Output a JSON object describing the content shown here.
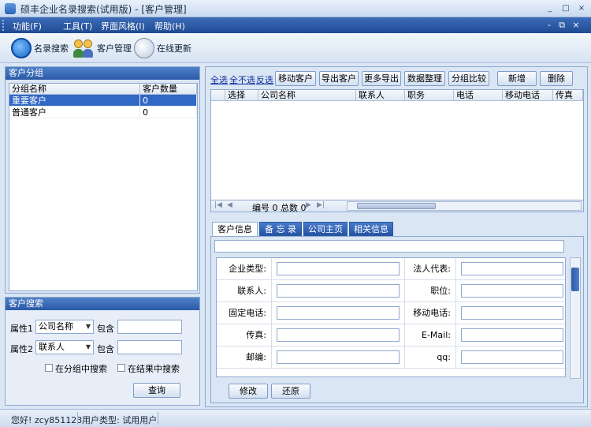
{
  "window": {
    "title": "硕丰企业名录搜索(试用版) - [客户管理]",
    "controls": [
      "_",
      "□",
      "×"
    ]
  },
  "menu": {
    "items": [
      "功能(F)",
      "工具(T)",
      "界面风格(I)",
      "帮助(H)"
    ],
    "mdi_controls": [
      "-",
      "⧉",
      "×"
    ]
  },
  "toolbar": {
    "search_label": "名录搜索",
    "customer_label": "客户管理",
    "update_label": "在线更新"
  },
  "group_panel": {
    "header": "客户分组",
    "columns": [
      "分组名称",
      "客户数量"
    ],
    "rows": [
      {
        "name": "重要客户",
        "count": "0",
        "selected": true
      },
      {
        "name": "普通客户",
        "count": "0",
        "selected": false
      }
    ]
  },
  "search_panel": {
    "header": "客户搜索",
    "attr1_label": "属性1",
    "attr1_value": "公司名称",
    "attr1_op": "包含",
    "attr2_label": "属性2",
    "attr2_value": "联系人",
    "attr2_op": "包含",
    "in_group_label": "在分组中搜索",
    "in_result_label": "在结果中搜索",
    "query_button": "查询"
  },
  "actions": {
    "select_all": "全选",
    "select_none": "全不选",
    "invert": "反选",
    "move": "移动客户",
    "export": "导出客户",
    "more_export": "更多导出",
    "organize": "数据整理",
    "compare": "分组比较",
    "add": "新增",
    "delete": "删除"
  },
  "grid": {
    "columns": [
      "选择",
      "公司名称",
      "联系人",
      "职务",
      "电话",
      "移动电话",
      "传真"
    ],
    "nav_text": "编号 0 总数 0"
  },
  "tabs": [
    "客户信息",
    "备 忘 录",
    "公司主页",
    "相关信息"
  ],
  "form": {
    "rows": [
      {
        "left": "企业类型:",
        "right": "法人代表:"
      },
      {
        "left": "联系人:",
        "right": "职位:"
      },
      {
        "left": "固定电话:",
        "right": "移动电话:"
      },
      {
        "left": "传真:",
        "right": "E-Mail:"
      },
      {
        "left": "邮编:",
        "right": "qq:"
      }
    ],
    "modify_button": "修改",
    "restore_button": "还原"
  },
  "status": {
    "greeting": "您好! zcy851123",
    "user_type": "用户类型: 试用用户"
  }
}
